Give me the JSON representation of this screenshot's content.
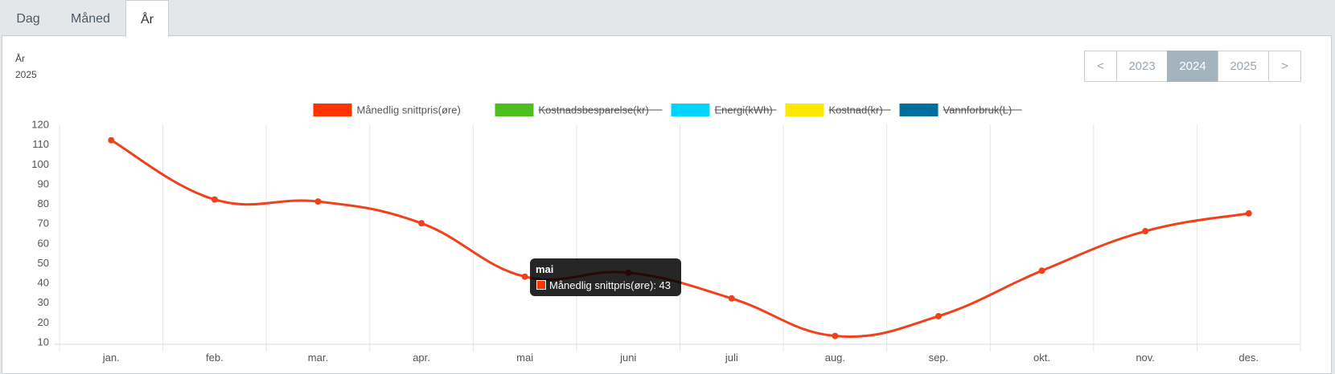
{
  "tabs": [
    {
      "label": "Dag"
    },
    {
      "label": "Måned"
    },
    {
      "label": "År"
    }
  ],
  "period": {
    "label": "År",
    "value": "2025"
  },
  "year_nav": {
    "prev": "<",
    "years": [
      "2023",
      "2024",
      "2025"
    ],
    "selected": "2024",
    "next": ">"
  },
  "legend": [
    {
      "label": "Månedlig snittpris(øre)",
      "color": "#ff3300",
      "hidden": false
    },
    {
      "label": "Kostnadsbesparelse(kr)",
      "color": "#4cbf1f",
      "hidden": true
    },
    {
      "label": "Energi(kWh)",
      "color": "#00d4ff",
      "hidden": true
    },
    {
      "label": "Kostnad(kr)",
      "color": "#ffe800",
      "hidden": true
    },
    {
      "label": "Vannforbruk(L)",
      "color": "#006fa0",
      "hidden": true
    }
  ],
  "tooltip": {
    "title": "mai",
    "text": "Månedlig snittpris(øre): 43"
  },
  "chart_data": {
    "type": "line",
    "categories": [
      "jan.",
      "feb.",
      "mar.",
      "apr.",
      "mai",
      "juni",
      "juli",
      "aug.",
      "sep.",
      "okt.",
      "nov.",
      "des."
    ],
    "series": [
      {
        "name": "Månedlig snittpris(øre)",
        "values": [
          112,
          82,
          81,
          70,
          43,
          45,
          32,
          13,
          23,
          46,
          66,
          75
        ],
        "color": "#f0401c"
      }
    ],
    "y_ticks": [
      10,
      20,
      30,
      40,
      50,
      60,
      70,
      80,
      90,
      100,
      110,
      120
    ],
    "ylim": [
      10,
      120
    ],
    "grid": true,
    "legend_position": "top"
  }
}
